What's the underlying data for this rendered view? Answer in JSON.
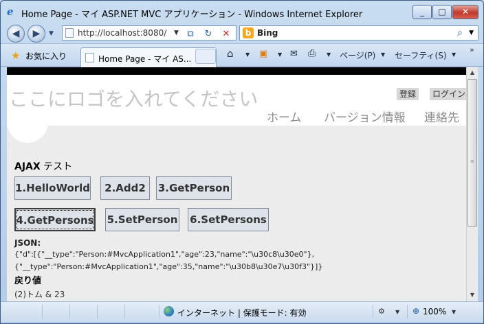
{
  "window": {
    "title": "Home Page - マイ ASP.NET MVC アプリケーション - Windows Internet Explorer"
  },
  "nav": {
    "url": "http://localhost:8080/",
    "search_engine": "Bing"
  },
  "favorites": {
    "label": "お気に入り",
    "tab_title": "Home Page - マイ AS...",
    "page_menu": "ページ(P)",
    "safety_menu": "セーフティ(S)"
  },
  "site": {
    "logo_text": "ここにロゴを入れてください",
    "login_links": [
      "登録",
      "ログイン"
    ],
    "menu": [
      "ホーム",
      "バージョン情報",
      "連絡先"
    ]
  },
  "ajax": {
    "heading_bold": "AJAX",
    "heading_rest": " テスト",
    "buttons": [
      "1.HelloWorld",
      "2.Add2",
      "3.GetPerson",
      "4.GetPersons",
      "5.SetPerson",
      "6.SetPersons"
    ],
    "json_label": "JSON:",
    "json_lines": [
      "{\"d\":[{\"__type\":\"Person:#MvcApplication1\",\"age\":23,\"name\":\"\\u30c8\\u30e0\"},",
      "{\"__type\":\"Person:#MvcApplication1\",\"age\":35,\"name\":\"\\u30b8\\u30e7\\u30f3\"}]}"
    ],
    "return_label": "戻り値",
    "return_value": "(2)トム & 23"
  },
  "status": {
    "zone": "インターネット | 保護モード: 有効",
    "zoom": "100%"
  }
}
